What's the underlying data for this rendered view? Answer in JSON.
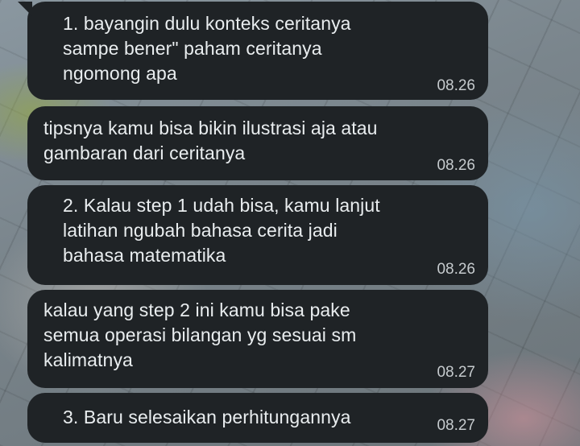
{
  "messages": [
    {
      "text": "1. bayangin dulu konteks ceritanya\nsampe bener\" paham ceritanya\nngomong apa",
      "time": "08.26"
    },
    {
      "text": "tipsnya kamu bisa bikin ilustrasi aja atau\ngambaran dari ceritanya",
      "time": "08.26"
    },
    {
      "text": "2. Kalau step 1 udah bisa, kamu lanjut\nlatihan ngubah bahasa cerita jadi\nbahasa matematika",
      "time": "08.26"
    },
    {
      "text": "kalau yang step 2 ini kamu bisa pake\nsemua operasi bilangan yg sesuai sm\nkalimatnya",
      "time": "08.27"
    },
    {
      "text": "3. Baru selesaikan perhitungannya",
      "time": "08.27"
    }
  ]
}
